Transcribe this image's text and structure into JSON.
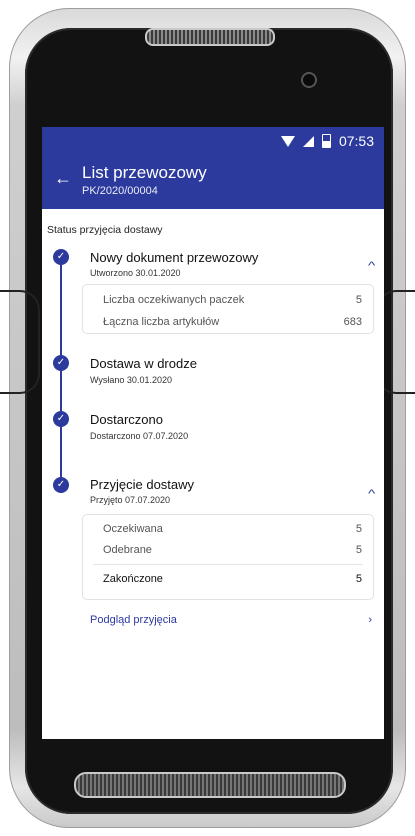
{
  "statusbar": {
    "time": "07:53"
  },
  "appbar": {
    "back_icon": "arrow-left-icon",
    "title": "List przewozowy",
    "subtitle": "PK/2020/00004"
  },
  "section_title": "Status przyjęcia dostawy",
  "steps": [
    {
      "title": "Nowy dokument przewozowy",
      "subtitle": "Utworzono 30.01.2020",
      "expanded": true,
      "details": [
        {
          "label": "Liczba oczekiwanych paczek",
          "value": "5"
        },
        {
          "label": "Łączna liczba artykułów",
          "value": "683"
        }
      ]
    },
    {
      "title": "Dostawa w drodze",
      "subtitle": "Wysłano 30.01.2020"
    },
    {
      "title": "Dostarczono",
      "subtitle": "Dostarczono 07.07.2020"
    },
    {
      "title": "Przyjęcie dostawy",
      "subtitle": "Przyjęto 07.07.2020",
      "expanded": true,
      "details": [
        {
          "label": "Oczekiwana",
          "value": "5"
        },
        {
          "label": "Odebrane",
          "value": "5"
        },
        {
          "label": "Zakończone",
          "value": "5"
        }
      ],
      "link": "Podgląd przyjęcia"
    }
  ],
  "colors": {
    "primary": "#2c3a9e"
  }
}
